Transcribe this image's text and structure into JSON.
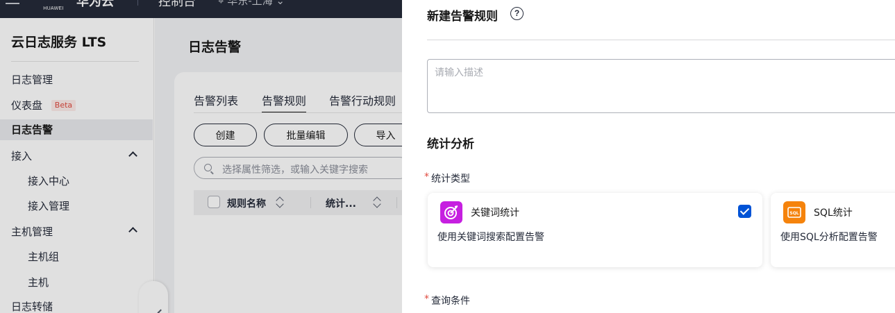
{
  "topbar": {
    "logo_text": "HUAWEI",
    "console_title": "华为云",
    "console_label": "控制台",
    "region": "华东-上海"
  },
  "leftnav": {
    "title": "云日志服务 LTS",
    "items": [
      {
        "label": "日志管理"
      },
      {
        "label": "仪表盘",
        "badge": "Beta"
      },
      {
        "label": "日志告警"
      },
      {
        "label": "接入"
      },
      {
        "label": "接入中心"
      },
      {
        "label": "接入管理"
      },
      {
        "label": "主机管理"
      },
      {
        "label": "主机组"
      },
      {
        "label": "主机"
      },
      {
        "label": "日志转储"
      }
    ]
  },
  "main": {
    "page_title": "日志告警",
    "tabs": [
      {
        "label": "告警列表"
      },
      {
        "label": "告警规则"
      },
      {
        "label": "告警行动规则"
      }
    ],
    "buttons": {
      "create": "创建",
      "batch_edit": "批量编辑",
      "import": "导入"
    },
    "search_placeholder": "选择属性筛选，或输入关键字搜索",
    "table": {
      "col_name": "规则名称",
      "col_stat": "统计..."
    }
  },
  "drawer": {
    "title": "新建告警规则",
    "help_glyph": "?",
    "desc_placeholder": "请输入描述",
    "section_title": "统计分析",
    "stat_type_label": "统计类型",
    "required_mark": "*",
    "options": [
      {
        "title": "关键词统计",
        "desc": "使用关键词搜索配置告警",
        "checked": true,
        "color": "#c61fe0"
      },
      {
        "title": "SQL统计",
        "desc": "使用SQL分析配置告警",
        "checked": false,
        "color": "#f5830c",
        "icon_text": "SQL"
      }
    ],
    "query_label": "查询条件"
  }
}
